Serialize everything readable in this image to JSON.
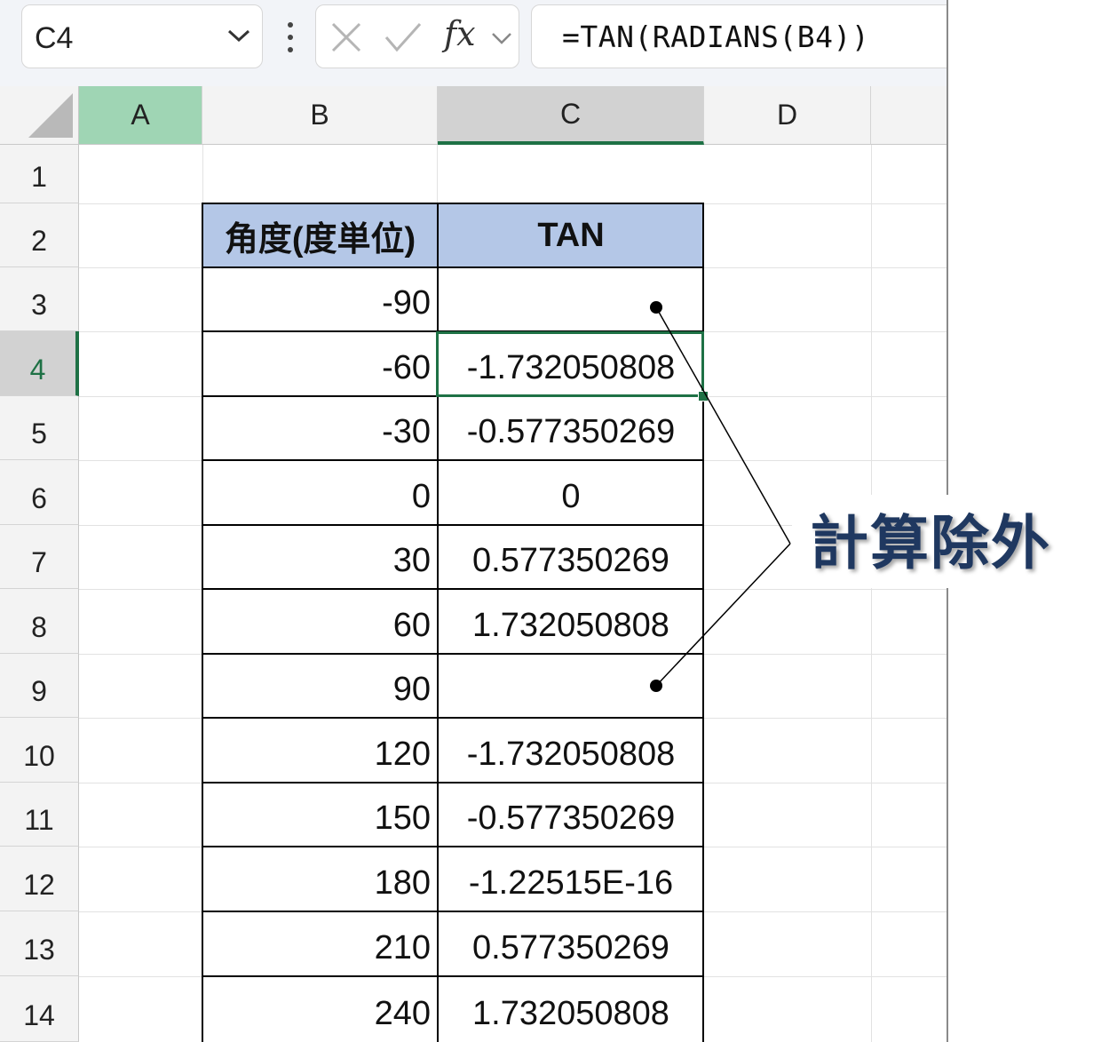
{
  "formula_bar": {
    "name_box": "C4",
    "fx_label": "fx",
    "formula": "=TAN(RADIANS(B4))"
  },
  "columns": [
    "A",
    "B",
    "C",
    "D"
  ],
  "rows": [
    "1",
    "2",
    "3",
    "4",
    "5",
    "6",
    "7",
    "8",
    "9",
    "10",
    "11",
    "12",
    "13",
    "14"
  ],
  "table": {
    "headers": [
      "角度(度単位)",
      "TAN"
    ],
    "rows": [
      [
        "-90",
        ""
      ],
      [
        "-60",
        "-1.732050808"
      ],
      [
        "-30",
        "-0.577350269"
      ],
      [
        "0",
        "0"
      ],
      [
        "30",
        "0.577350269"
      ],
      [
        "60",
        "1.732050808"
      ],
      [
        "90",
        ""
      ],
      [
        "120",
        "-1.732050808"
      ],
      [
        "150",
        "-0.577350269"
      ],
      [
        "180",
        "-1.22515E-16"
      ],
      [
        "210",
        "0.577350269"
      ],
      [
        "240",
        "1.732050808"
      ]
    ]
  },
  "selection": {
    "cell": "C4"
  },
  "annotation": {
    "label": "計算除外"
  },
  "colors": {
    "header_fill": "#b4c7e7",
    "selection": "#1e7145",
    "annotation_text": "#1f3860"
  }
}
